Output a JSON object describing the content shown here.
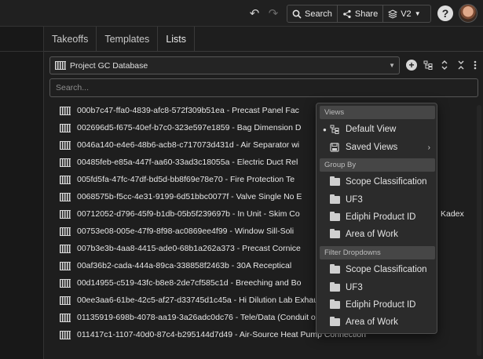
{
  "topbar": {
    "search_label": "Search",
    "share_label": "Share",
    "version_label": "V2",
    "help_label": "?"
  },
  "tabs": [
    {
      "label": "Takeoffs"
    },
    {
      "label": "Templates"
    },
    {
      "label": "Lists"
    }
  ],
  "database": {
    "selected": "Project GC Database"
  },
  "search": {
    "placeholder": "Search..."
  },
  "items": [
    {
      "label": "000b7c47-ffa0-4839-afc8-572f309b51ea - Precast Panel Fac"
    },
    {
      "label": "002696d5-f675-40ef-b7c0-323e597e1859 - Bag Dimension D"
    },
    {
      "label": "0046a140-e4e6-48b6-acb8-c717073d431d - Air Separator wi"
    },
    {
      "label": "00485feb-e85a-447f-aa60-33ad3c18055a - Electric Duct Rel"
    },
    {
      "label": "005fd5fa-47fc-47df-bd5d-bb8f69e78e70 - Fire Protection Te"
    },
    {
      "label": "0068575b-f5cc-4e31-9199-6d51bbc0077f - Valve Single No E"
    },
    {
      "label": "00712052-d796-45f9-b1db-05b5f239697b - In Unit - Skim Co",
      "tail": "Kadex"
    },
    {
      "label": "00753e08-005e-47f9-8f98-ac0869ee4f99 - Window Sill-Soli"
    },
    {
      "label": "007b3e3b-4aa8-4415-ade0-68b1a262a373 - Precast Cornice"
    },
    {
      "label": "00af36b2-cada-444a-89ca-338858f2463b - 30A Receptical"
    },
    {
      "label": "00d14955-c519-43fc-b8e8-2de7cf585c1d - Breeching and Bo"
    },
    {
      "label": "00ee3aa6-61be-42c5-af27-d33745d1c45a - Hi Dilution Lab Exhaust Fan"
    },
    {
      "label": "01135919-698b-4078-aa19-3a26adc0dc76 - Tele/Data (Conduit only)"
    },
    {
      "label": "011417c1-1107-40d0-87c4-b295144d7d49 - Air-Source Heat Pump Connection"
    }
  ],
  "menu": {
    "views_header": "Views",
    "default_view": "Default View",
    "saved_views": "Saved Views",
    "group_by_header": "Group By",
    "group_by": [
      "Scope Classification",
      "UF3",
      "Ediphi Product ID",
      "Area of Work"
    ],
    "filter_header": "Filter Dropdowns",
    "filter": [
      "Scope Classification",
      "UF3",
      "Ediphi Product ID",
      "Area of Work"
    ]
  }
}
